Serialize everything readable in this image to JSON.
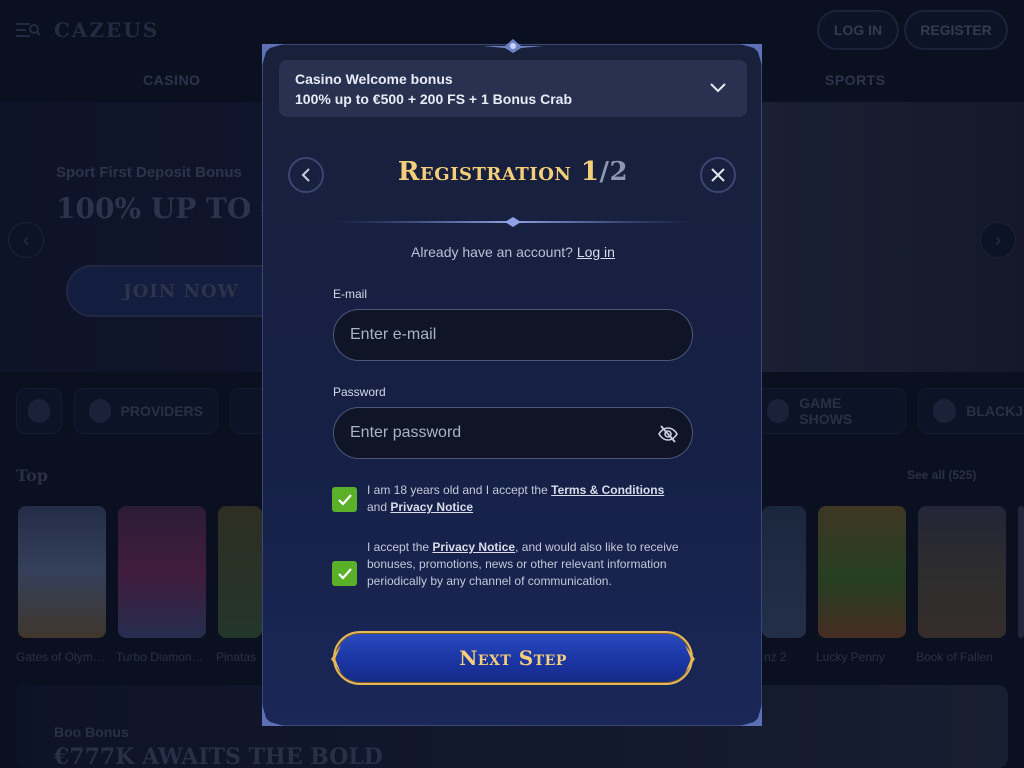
{
  "background": {
    "logo": "CAZEUS",
    "header": {
      "login_label": "LOG IN",
      "register_label": "REGISTER"
    },
    "nav_tabs": [
      "CASINO",
      "SPORTS"
    ],
    "hero": {
      "subtitle": "Sport First Deposit Bonus",
      "title": "100% UP TO €",
      "button_label": "JOIN NOW"
    },
    "categories": [
      "PROVIDERS",
      "GAME SHOWS",
      "BLACKJ"
    ],
    "top_section": {
      "title": "Top",
      "see_all": "See all (525)"
    },
    "games": [
      "Gates of Olym…",
      "Turbo Diamon…",
      "Pinatas",
      "nz 2",
      "Lucky Penny",
      "Book of Fallen"
    ],
    "boo_section": {
      "subtitle": "Boo Bonus",
      "title": "€777K AWAITS THE BOLD"
    }
  },
  "modal": {
    "bonus": {
      "title": "Casino Welcome bonus",
      "detail": "100% up to €500 + 200 FS + 1 Bonus Crab"
    },
    "title": "Registration 1",
    "title_step": "/2",
    "have_account_text": "Already have an account?",
    "login_link": "Log in",
    "email": {
      "label": "E-mail",
      "placeholder": "Enter e-mail",
      "value": ""
    },
    "password": {
      "label": "Password",
      "placeholder": "Enter password",
      "value": ""
    },
    "consent_age": {
      "checked": true,
      "text_before": "I am 18 years old and I accept the",
      "terms_link": "Terms & Conditions",
      "text_and": "and",
      "privacy_link": "Privacy Notice"
    },
    "consent_marketing": {
      "checked": true,
      "text_before": "I accept the",
      "privacy_link": "Privacy Notice",
      "text_after": ", and would also like to receive bonuses, promotions, news or other relevant information periodically by any channel of communication."
    },
    "next_button_label": "Next Step"
  },
  "colors": {
    "gold": "#f4cf79",
    "checkbox_green": "#5bb02a",
    "button_blue": "#1b35a3",
    "modal_bg": "#18203a"
  },
  "icons": [
    "menu-icon",
    "chevron-down-icon",
    "chevron-left-icon",
    "close-icon",
    "eye-off-icon",
    "check-icon"
  ]
}
